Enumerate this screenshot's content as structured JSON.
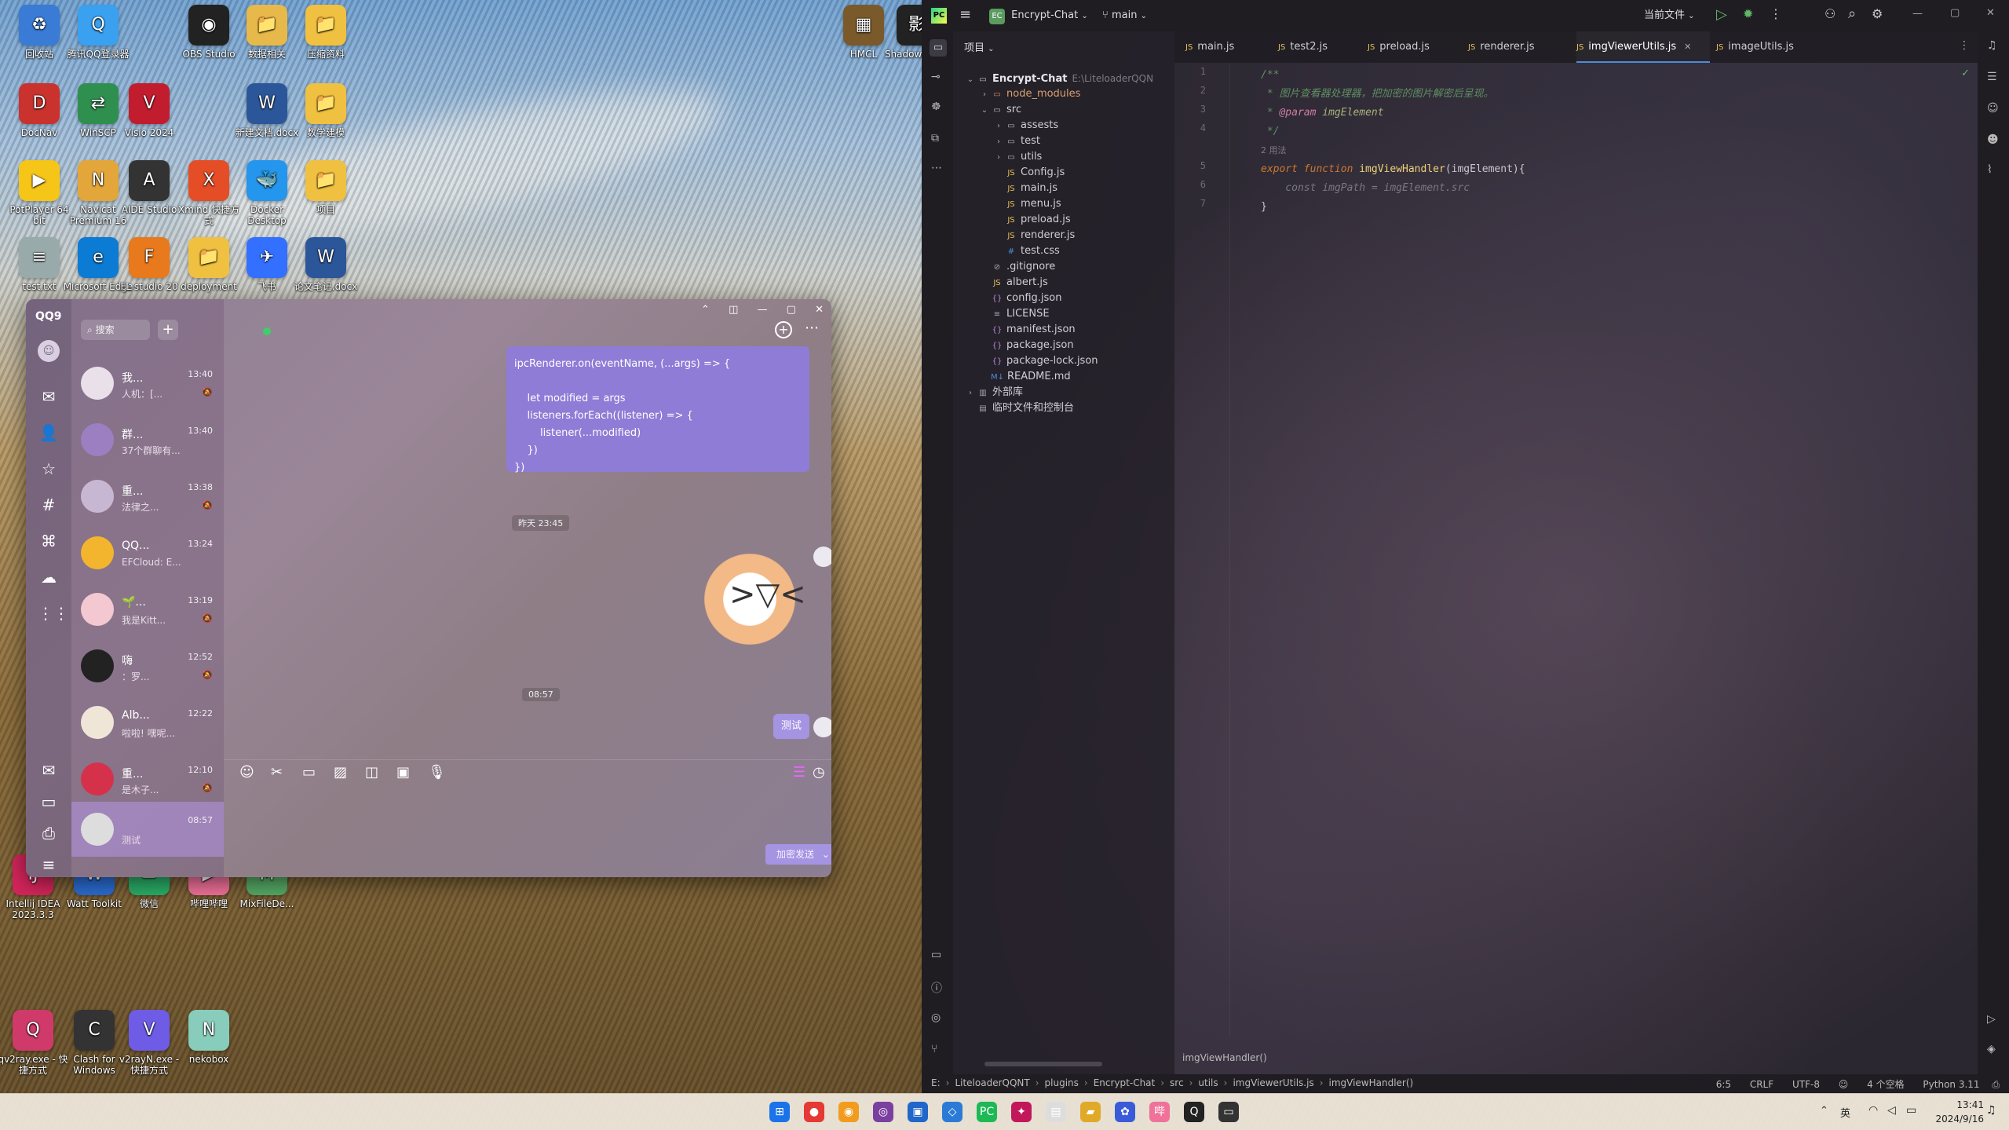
{
  "desktop": {
    "icons": [
      {
        "label": "回收站",
        "glyph": "♻",
        "color": "#3a7bd5"
      },
      {
        "label": "腾讯QQ登录器",
        "glyph": "Q",
        "color": "#3aa0f0"
      },
      {
        "label": "OBS Studio",
        "glyph": "◉",
        "color": "#222"
      },
      {
        "label": "数据相关",
        "glyph": "📁",
        "color": "#e6b94a"
      },
      {
        "label": "压缩资料",
        "glyph": "📁",
        "color": "#f0c040"
      },
      {
        "label": "HMCL",
        "glyph": "▦",
        "color": "#7a5a2a"
      },
      {
        "label": "ShadowSocks",
        "glyph": "影",
        "color": "#222"
      },
      {
        "label": "DocNav",
        "glyph": "D",
        "color": "#c9322d"
      },
      {
        "label": "WinSCP",
        "glyph": "⇄",
        "color": "#2f8f4f"
      },
      {
        "label": "Visio 2024",
        "glyph": "V",
        "color": "#c21d2e"
      },
      {
        "label": "新建文档.docx",
        "glyph": "W",
        "color": "#2b579a"
      },
      {
        "label": "数学建模",
        "glyph": "📁",
        "color": "#f0c040"
      },
      {
        "label": "PotPlayer 64 bit",
        "glyph": "▶",
        "color": "#f5c518"
      },
      {
        "label": "Navicat Premium 16",
        "glyph": "N",
        "color": "#e3a63a"
      },
      {
        "label": "AIDE Studio",
        "glyph": "A",
        "color": "#333"
      },
      {
        "label": "Xmind 快捷方式",
        "glyph": "X",
        "color": "#e44d26"
      },
      {
        "label": "Docker Desktop",
        "glyph": "🐳",
        "color": "#2496ed"
      },
      {
        "label": "项目",
        "glyph": "📁",
        "color": "#f0c040"
      },
      {
        "label": "test.txt",
        "glyph": "≡",
        "color": "#9aa"
      },
      {
        "label": "Microsoft Edge",
        "glyph": "e",
        "color": "#0c7bd4"
      },
      {
        "label": "FL studio 20",
        "glyph": "F",
        "color": "#e8791c"
      },
      {
        "label": "deployment",
        "glyph": "📁",
        "color": "#f0c040"
      },
      {
        "label": "飞书",
        "glyph": "✈",
        "color": "#3370ff"
      },
      {
        "label": "论文笔记.docx",
        "glyph": "W",
        "color": "#2b579a"
      },
      {
        "label": "Intellij IDEA 2023.3.3",
        "glyph": "IJ",
        "color": "#d4255b"
      },
      {
        "label": "Watt Toolkit",
        "glyph": "W",
        "color": "#2a6cd0"
      },
      {
        "label": "微信",
        "glyph": "✉",
        "color": "#2aae67"
      },
      {
        "label": "哔哩哔哩",
        "glyph": "▶",
        "color": "#f07199"
      },
      {
        "label": "MixFileDe...",
        "glyph": "M",
        "color": "#5a6"
      },
      {
        "label": "qv2ray.exe - 快捷方式",
        "glyph": "Q",
        "color": "#d03a6a"
      },
      {
        "label": "Clash for Windows",
        "glyph": "C",
        "color": "#333"
      },
      {
        "label": "v2rayN.exe - 快捷方式",
        "glyph": "V",
        "color": "#6e5ce6"
      },
      {
        "label": "nekobox",
        "glyph": "N",
        "color": "#8cb"
      }
    ]
  },
  "qq": {
    "logo": "QQ9",
    "search_placeholder": "搜索",
    "add": "+",
    "conversations": [
      {
        "name": "我...",
        "preview": "人机：[...",
        "time": "13:40",
        "muted": true,
        "color": "#e9e0ea"
      },
      {
        "name": "群...",
        "preview": "37个群聊有...",
        "time": "13:40",
        "muted": false,
        "color": "#9b7fc0"
      },
      {
        "name": "重...",
        "preview": "法律之...",
        "time": "13:38",
        "muted": true,
        "color": "#c8b7d3"
      },
      {
        "name": "QQ...",
        "preview": "EFCloud: E...",
        "time": "13:24",
        "muted": false,
        "color": "#f3b52d"
      },
      {
        "name": "🌱...",
        "preview": "我是Kitt...",
        "time": "13:19",
        "muted": true,
        "color": "#f3c8d0"
      },
      {
        "name": "嗨",
        "preview": "：罗...",
        "time": "12:52",
        "muted": true,
        "color": "#222"
      },
      {
        "name": "Alb...",
        "preview": "啦啦! 嘿呢...",
        "time": "12:22",
        "muted": false,
        "color": "#efe6d8"
      },
      {
        "name": "重...",
        "preview": "是木子...",
        "time": "12:10",
        "muted": true,
        "color": "#d6314b"
      },
      {
        "name": "",
        "preview": "测试",
        "time": "08:57",
        "muted": false,
        "color": "#ddd"
      }
    ],
    "code_bubble": [
      "ipcRenderer.on(eventName, (...args) => {",
      "",
      "    let modified = args",
      "    listeners.forEach((listener) => {",
      "        listener(...modified)",
      "    })",
      "})"
    ],
    "time_sep_1": "昨天 23:45",
    "time_sep_2": "08:57",
    "test_msg": "测试",
    "send_label": "加密发送",
    "send_arrow": "⌄"
  },
  "ide": {
    "project_badge": "EC",
    "project_name": "Encrypt-Chat",
    "branch": "main",
    "current_file": "当前文件",
    "panel_title": "项目",
    "tree": [
      {
        "label": "Encrypt-Chat",
        "extra": "E:\\LiteloaderQQN",
        "depth": 0,
        "type": "root"
      },
      {
        "label": "node_modules",
        "depth": 1,
        "type": "folder-ex"
      },
      {
        "label": "src",
        "depth": 1,
        "type": "folder-open"
      },
      {
        "label": "assests",
        "depth": 2,
        "type": "folder"
      },
      {
        "label": "test",
        "depth": 2,
        "type": "folder"
      },
      {
        "label": "utils",
        "depth": 2,
        "type": "folder"
      },
      {
        "label": "Config.js",
        "depth": 2,
        "type": "js"
      },
      {
        "label": "main.js",
        "depth": 2,
        "type": "js"
      },
      {
        "label": "menu.js",
        "depth": 2,
        "type": "js"
      },
      {
        "label": "preload.js",
        "depth": 2,
        "type": "js"
      },
      {
        "label": "renderer.js",
        "depth": 2,
        "type": "js"
      },
      {
        "label": "test.css",
        "depth": 2,
        "type": "css"
      },
      {
        "label": ".gitignore",
        "depth": 1,
        "type": "git"
      },
      {
        "label": "albert.js",
        "depth": 1,
        "type": "js"
      },
      {
        "label": "config.json",
        "depth": 1,
        "type": "json"
      },
      {
        "label": "LICENSE",
        "depth": 1,
        "type": "txt"
      },
      {
        "label": "manifest.json",
        "depth": 1,
        "type": "json"
      },
      {
        "label": "package.json",
        "depth": 1,
        "type": "json"
      },
      {
        "label": "package-lock.json",
        "depth": 1,
        "type": "json"
      },
      {
        "label": "README.md",
        "depth": 1,
        "type": "md"
      },
      {
        "label": "外部库",
        "depth": 0,
        "type": "lib"
      },
      {
        "label": "临时文件和控制台",
        "depth": 0,
        "type": "scratch"
      }
    ],
    "tabs": [
      {
        "label": "main.js",
        "active": false
      },
      {
        "label": "test2.js",
        "active": false
      },
      {
        "label": "preload.js",
        "active": false
      },
      {
        "label": "renderer.js",
        "active": false
      },
      {
        "label": "imgViewerUtils.js",
        "active": true
      },
      {
        "label": "imageUtils.js",
        "active": false
      }
    ],
    "code": {
      "l1": "/**",
      "l2": " * 图片查看器处理器，把加密的图片解密后呈现。",
      "l3a": " * ",
      "l3b": "@param",
      "l3c": " imgElement",
      "l4": " */",
      "usages": "2 用法",
      "l5a": "export function ",
      "l5b": "imgViewHandler",
      "l5c": "(imgElement){",
      "l6": "    const imgPath = imgElement.src",
      "l7": "}"
    },
    "breadcrumb_func": "imgViewHandler()",
    "status": {
      "path": [
        "E:",
        "LiteloaderQQNT",
        "plugins",
        "Encrypt-Chat",
        "src",
        "utils",
        "imgViewerUtils.js",
        "imgViewHandler()"
      ],
      "position": "6:5",
      "line_sep": "CRLF",
      "encoding": "UTF-8",
      "indent": "4 个空格",
      "interpreter": "Python 3.11"
    }
  },
  "taskbar": {
    "apps": [
      {
        "glyph": "⊞",
        "color": "#1a73e8"
      },
      {
        "glyph": "●",
        "color": "#e53935"
      },
      {
        "glyph": "◉",
        "color": "#f29c1f"
      },
      {
        "glyph": "◎",
        "color": "#7b3fa0"
      },
      {
        "glyph": "▣",
        "color": "#2166c9"
      },
      {
        "glyph": "◇",
        "color": "#2b7bd6"
      },
      {
        "glyph": "PC",
        "color": "#1db954"
      },
      {
        "glyph": "✦",
        "color": "#c2185b"
      },
      {
        "glyph": "▤",
        "color": "#ddd"
      },
      {
        "glyph": "▰",
        "color": "#e0a928"
      },
      {
        "glyph": "✿",
        "color": "#3a5bd9"
      },
      {
        "glyph": "哔",
        "color": "#f07199"
      },
      {
        "glyph": "Q",
        "color": "#222"
      },
      {
        "glyph": "▭",
        "color": "#333"
      }
    ],
    "lang": "英",
    "time": "13:41",
    "date": "2024/9/16"
  }
}
